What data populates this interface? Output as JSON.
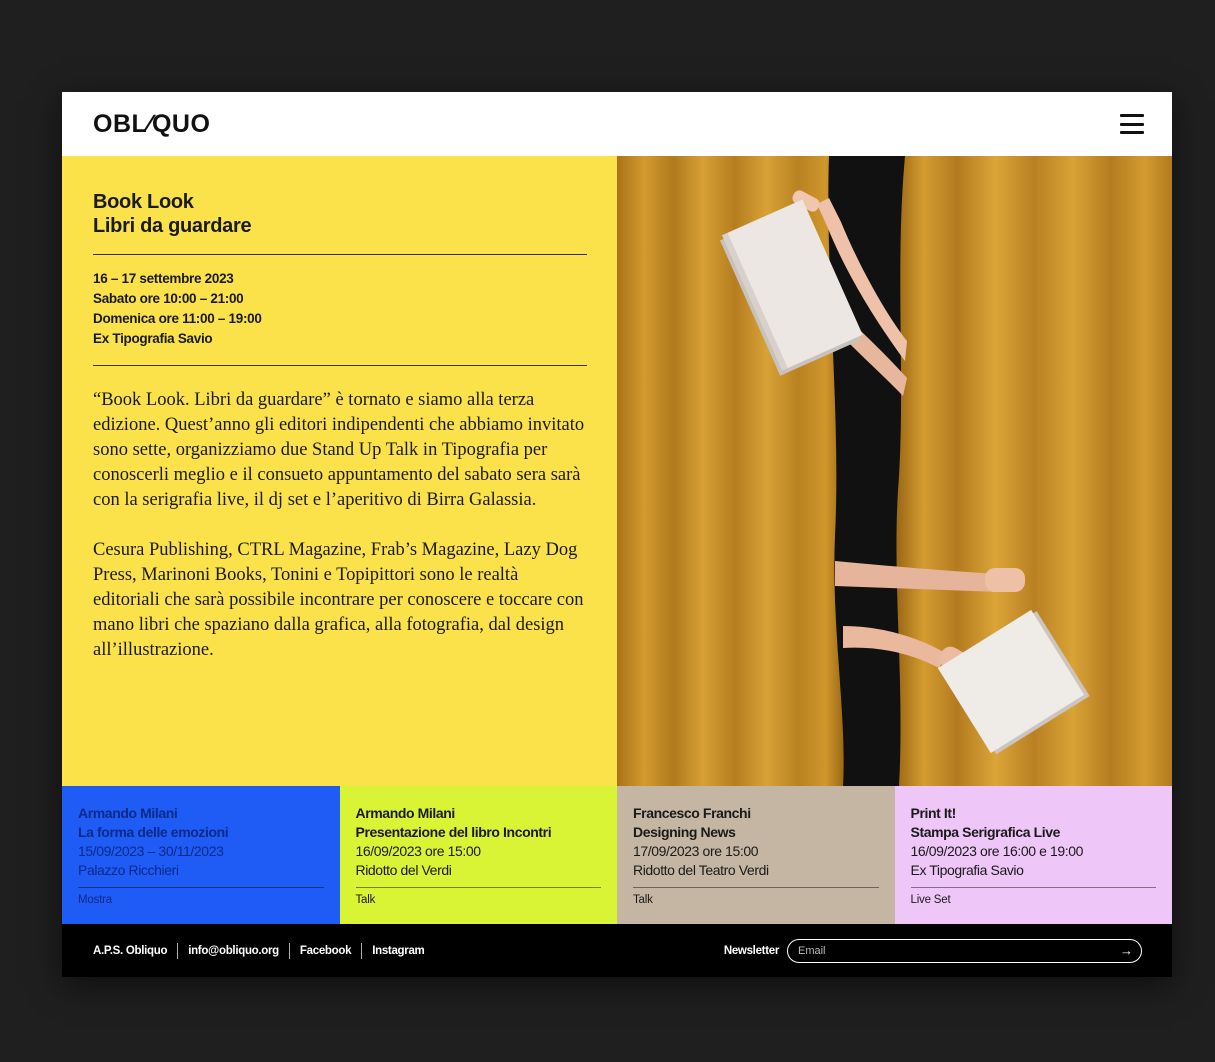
{
  "header": {
    "logo": "OBL∕QUO",
    "menu_icon": "hamburger-menu-icon"
  },
  "event": {
    "title_line1": "Book Look",
    "title_line2": "Libri da guardare",
    "info": [
      "16 – 17 settembre 2023",
      "Sabato ore 10:00 – 21:00",
      "Domenica ore 11:00 – 19:00",
      "Ex Tipografia Savio"
    ],
    "paragraph1": "“Book Look. Libri da guardare” è tornato e siamo alla terza edizione. Quest’anno gli editori indipendenti che abbiamo invitato sono sette, organizziamo due Stand Up Talk in Tipografia per conoscerli meglio e il consueto appuntamento del sabato sera sarà con la serigrafia live, il dj set e l’aperitivo di Birra Galassia.",
    "paragraph2": "Cesura Publishing, CTRL Magazine, Frab’s Magazine, Lazy Dog Press, Marinoni Books, Tonini e Topipittori sono le realtà editoriali che sarà possibile incontrare per conoscere e toccare con mano libri che spaziano dalla grafica, alla fotografia, dal design all’illustrazione."
  },
  "cards": [
    {
      "author": "Armando Milani",
      "title": "La forma delle emozioni",
      "date": "15/09/2023 – 30/11/2023",
      "place": "Palazzo Ricchieri",
      "category": "Mostra",
      "bg": "#1f5cf5",
      "text_color": "#0c2a8a"
    },
    {
      "author": "Armando Milani",
      "title": "Presentazione del libro Incontri",
      "date": "16/09/2023 ore 15:00",
      "place": "Ridotto del Verdi",
      "category": "Talk",
      "bg": "#d8f435",
      "text_color": "#1a1a1a"
    },
    {
      "author": "Francesco Franchi",
      "title": "Designing News",
      "date": "17/09/2023 ore 15:00",
      "place": "Ridotto del Teatro Verdi",
      "category": "Talk",
      "bg": "#c4b6a2",
      "text_color": "#1a1a1a"
    },
    {
      "author": "Print It!",
      "title": "Stampa Serigrafica Live",
      "date": "16/09/2023 ore 16:00 e 19:00",
      "place": "Ex Tipografia Savio",
      "category": "Live Set",
      "bg": "#eec6f8",
      "text_color": "#1a1a1a"
    }
  ],
  "footer": {
    "org": "A.P.S. Obliquo",
    "email": "info@obliquo.org",
    "facebook": "Facebook",
    "instagram": "Instagram",
    "newsletter_label": "Newsletter",
    "email_placeholder": "Email",
    "submit_icon": "arrow-right-icon"
  },
  "colors": {
    "hero_yellow": "#fbe24a",
    "curtain": "#c58f23",
    "footer_bg": "#000000"
  }
}
